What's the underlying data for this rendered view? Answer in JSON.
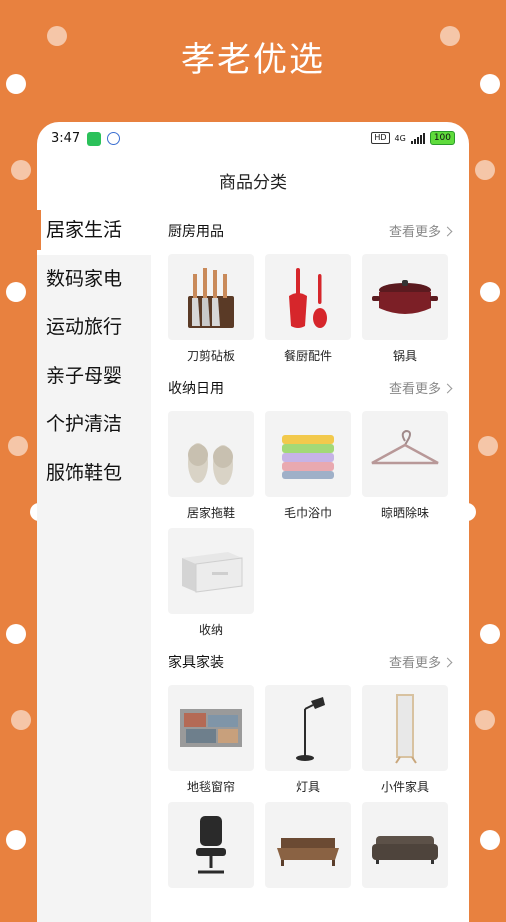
{
  "banner": {
    "title": "孝老优选"
  },
  "status_bar": {
    "time": "3:47",
    "hd": "HD",
    "network": "4G",
    "battery": "100"
  },
  "page_title": "商品分类",
  "sidebar": {
    "items": [
      {
        "label": "居家生活",
        "active": true
      },
      {
        "label": "数码家电"
      },
      {
        "label": "运动旅行"
      },
      {
        "label": "亲子母婴"
      },
      {
        "label": "个护清洁"
      },
      {
        "label": "服饰鞋包"
      }
    ]
  },
  "sections": [
    {
      "title": "厨房用品",
      "more": "查看更多",
      "items": [
        {
          "label": "刀剪砧板",
          "icon": "knife-block-icon"
        },
        {
          "label": "餐厨配件",
          "icon": "spatula-icon"
        },
        {
          "label": "锅具",
          "icon": "pot-icon"
        }
      ]
    },
    {
      "title": "收纳日用",
      "more": "查看更多",
      "items": [
        {
          "label": "居家拖鞋",
          "icon": "slippers-icon"
        },
        {
          "label": "毛巾浴巾",
          "icon": "towels-icon"
        },
        {
          "label": "晾晒除味",
          "icon": "hanger-icon"
        },
        {
          "label": "收纳",
          "icon": "storage-box-icon"
        }
      ]
    },
    {
      "title": "家具家装",
      "more": "查看更多",
      "items": [
        {
          "label": "地毯窗帘",
          "icon": "rug-icon"
        },
        {
          "label": "灯具",
          "icon": "lamp-icon"
        },
        {
          "label": "小件家具",
          "icon": "mirror-icon"
        },
        {
          "label": "",
          "icon": "office-chair-icon"
        },
        {
          "label": "",
          "icon": "bed-icon"
        },
        {
          "label": "",
          "icon": "sofa-icon"
        }
      ]
    }
  ],
  "colors": {
    "accent": "#E8813F",
    "sidebar_bg": "#F4F4F4",
    "tile_bg": "#F3F3F3"
  }
}
